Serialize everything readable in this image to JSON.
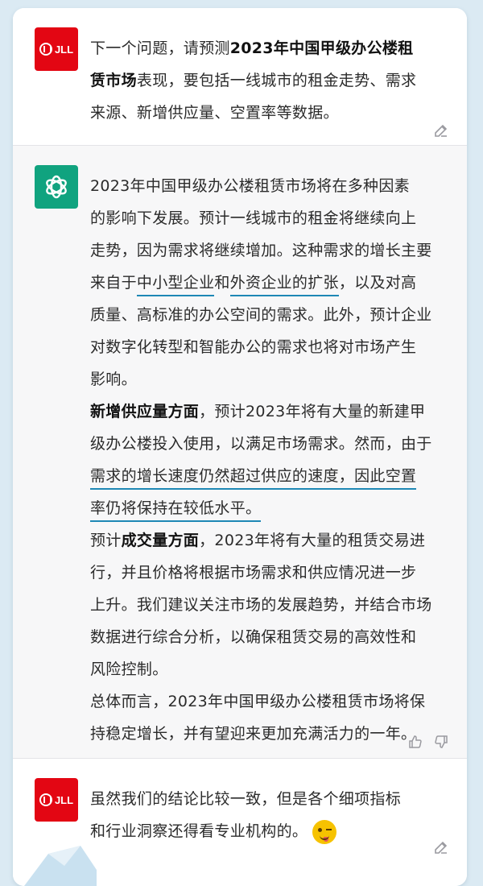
{
  "messages": {
    "user1": {
      "avatar_text": "JLL",
      "line1_pre": "下一个问题，请预测",
      "line1_bold": "2023年中国甲级办公楼租",
      "line2_bold": "赁市场",
      "line2_post": "表现，要包括一线城市的租金走势、需求",
      "line3": "来源、新增供应量、空置率等数据。"
    },
    "bot": {
      "p1_l1": "2023年中国甲级办公楼租赁市场将在多种因素",
      "p1_l2": "的影响下发展。预计一线城市的租金将继续向上",
      "p1_l3": "走势，因为需求将继续增加。这种需求的增长主要",
      "p1_l4_pre": "来自于",
      "p1_l4_link1": "中小型企业",
      "p1_l4_mid": "和",
      "p1_l4_link2": "外资企业的扩张",
      "p1_l4_post": "，以及对高",
      "p1_l5": "质量、高标准的办公空间的需求。此外，预计企业",
      "p1_l6": "对数字化转型和智能办公的需求也将对市场产生",
      "p1_l7": "影响。",
      "p2_bold": "新增供应量方面",
      "p2_l1_post": "，预计2023年将有大量的新建甲",
      "p2_l2": "级办公楼投入使用，以满足市场需求。然而，由于",
      "p2_l3_link": "需求的增长速度仍然超过供应的速度，因此空置",
      "p2_l4_link": "率仍将保持在较低水平。",
      "p3_pre": "预计",
      "p3_bold": "成交量方面",
      "p3_l1_post": "，2023年将有大量的租赁交易进",
      "p3_l2": "行，并且价格将根据市场需求和供应情况进一步",
      "p3_l3": "上升。我们建议关注市场的发展趋势，并结合市场",
      "p3_l4": "数据进行综合分析，以确保租赁交易的高效性和",
      "p3_l5": "风险控制。",
      "p4_l1": "总体而言，2023年中国甲级办公楼租赁市场将保",
      "p4_l2": "持稳定增长，并有望迎来更加充满活力的一年。"
    },
    "user2": {
      "avatar_text": "JLL",
      "line1": "虽然我们的结论比较一致，但是各个细项指标",
      "line2": "和行业洞察还得看专业机构的。"
    }
  },
  "icons": {
    "edit": "edit-icon",
    "thumbs_up": "thumbs-up-icon",
    "thumbs_down": "thumbs-down-icon",
    "emoji": "winking-face-emoji"
  },
  "colors": {
    "jll_red": "#e30613",
    "gpt_green": "#10a37f",
    "link_underline": "#1e88b5",
    "page_bg": "#dbeaf3"
  }
}
